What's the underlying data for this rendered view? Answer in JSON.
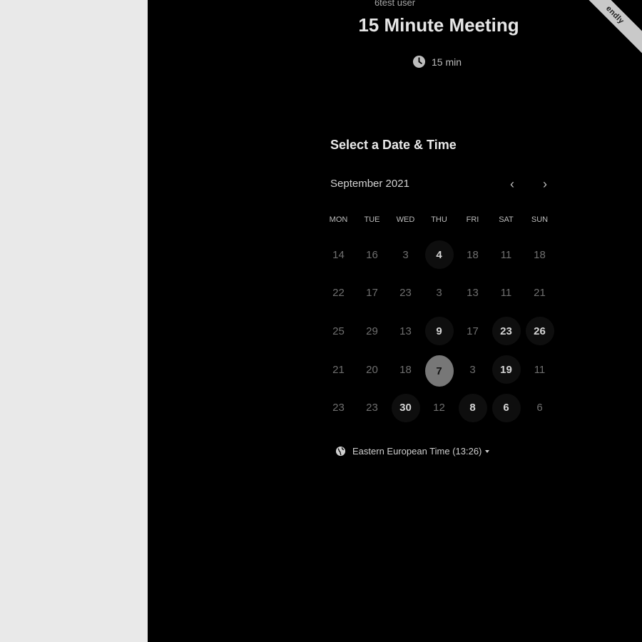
{
  "header": {
    "owner_name": "6test user",
    "event_title": "15 Minute Meeting",
    "duration": "15 min",
    "ribbon_text": "endly"
  },
  "scheduler": {
    "title": "Select a Date & Time",
    "month": "September 2021",
    "prev_label": "‹",
    "next_label": "›",
    "weekdays": [
      "MON",
      "TUE",
      "WED",
      "THU",
      "FRI",
      "SAT",
      "SUN"
    ],
    "weeks": [
      [
        {
          "label": "14",
          "state": "unavailable"
        },
        {
          "label": "16",
          "state": "unavailable"
        },
        {
          "label": "3",
          "state": "unavailable"
        },
        {
          "label": "4",
          "state": "available"
        },
        {
          "label": "18",
          "state": "unavailable"
        },
        {
          "label": "11",
          "state": "unavailable"
        },
        {
          "label": "18",
          "state": "unavailable"
        }
      ],
      [
        {
          "label": "22",
          "state": "unavailable"
        },
        {
          "label": "17",
          "state": "unavailable"
        },
        {
          "label": "23",
          "state": "unavailable"
        },
        {
          "label": "3",
          "state": "unavailable"
        },
        {
          "label": "13",
          "state": "unavailable"
        },
        {
          "label": "11",
          "state": "unavailable"
        },
        {
          "label": "21",
          "state": "unavailable"
        }
      ],
      [
        {
          "label": "25",
          "state": "unavailable"
        },
        {
          "label": "29",
          "state": "unavailable"
        },
        {
          "label": "13",
          "state": "unavailable"
        },
        {
          "label": "9",
          "state": "available"
        },
        {
          "label": "17",
          "state": "unavailable"
        },
        {
          "label": "23",
          "state": "available"
        },
        {
          "label": "26",
          "state": "available"
        }
      ],
      [
        {
          "label": "21",
          "state": "unavailable"
        },
        {
          "label": "20",
          "state": "unavailable"
        },
        {
          "label": "18",
          "state": "unavailable"
        },
        {
          "label": "7",
          "state": "selected"
        },
        {
          "label": "3",
          "state": "unavailable"
        },
        {
          "label": "19",
          "state": "available"
        },
        {
          "label": "11",
          "state": "unavailable"
        }
      ],
      [
        {
          "label": "23",
          "state": "unavailable"
        },
        {
          "label": "23",
          "state": "unavailable"
        },
        {
          "label": "30",
          "state": "available"
        },
        {
          "label": "12",
          "state": "unavailable"
        },
        {
          "label": "8",
          "state": "available"
        },
        {
          "label": "6",
          "state": "available"
        },
        {
          "label": "6",
          "state": "unavailable"
        }
      ]
    ],
    "timezone": "Eastern European Time (13:26)"
  },
  "icons": {
    "duration": "clock-icon",
    "timezone": "globe-icon",
    "timezone_dropdown": "caret-down-icon"
  },
  "colors": {
    "panel_background": "#000000",
    "page_background": "#e9e9e9",
    "selected_day": "#777777"
  }
}
